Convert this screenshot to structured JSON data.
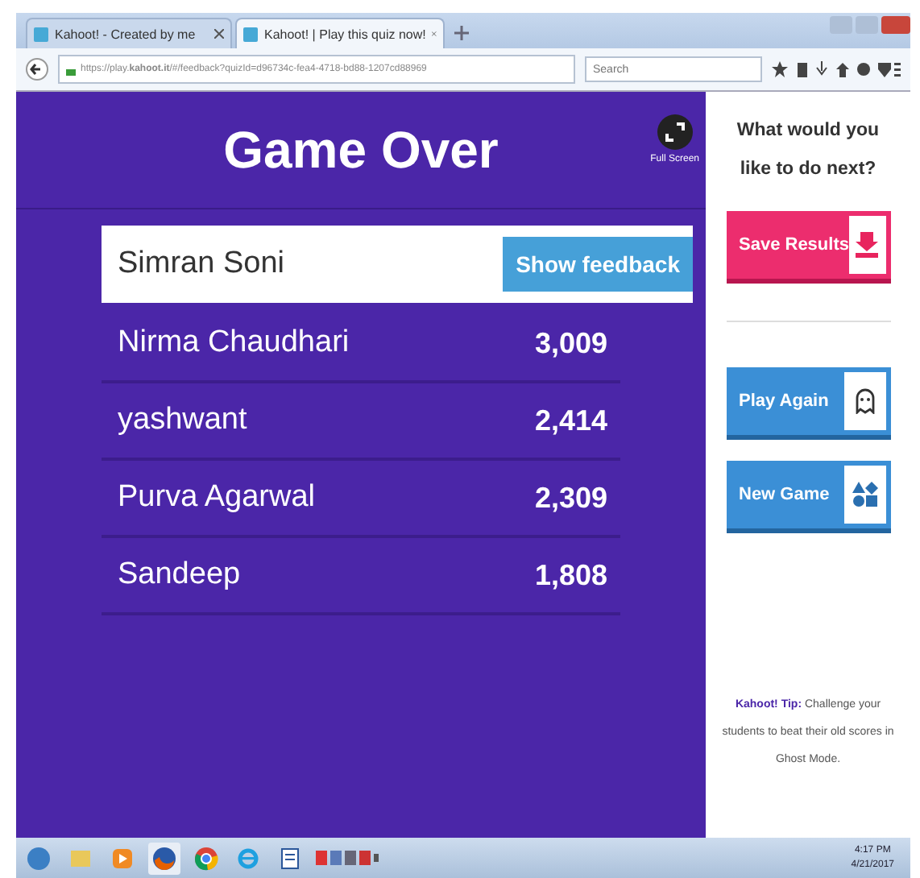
{
  "browser": {
    "tabs": [
      {
        "label": "Kahoot! - Created by me",
        "selected": false
      },
      {
        "label": "Kahoot! | Play this quiz now!",
        "selected": true
      }
    ],
    "url": "https://play.**kahoot.it**/#/feedback?quizId=d96734c-fea4-4718-bd88-1207cd88969",
    "search": {
      "placeholder": "Search"
    }
  },
  "game": {
    "title": "Game Over",
    "fullscreen_label": "Full Screen",
    "feedback_button": "Show feedback",
    "players": [
      {
        "name": "Simran Soni",
        "highlighted": true
      },
      {
        "name": "Nirma Chaudhari",
        "score": "3,009",
        "highlighted": false
      },
      {
        "name": "yashwant",
        "score": "2,414",
        "highlighted": false
      },
      {
        "name": "Purva Agarwal",
        "score": "2,309",
        "highlighted": false
      },
      {
        "name": "Sandeep",
        "score": "1,808",
        "highlighted": false
      }
    ]
  },
  "sidebar": {
    "question": "What would you like to do next?",
    "actions": [
      {
        "label": "Save Results",
        "kind": "save"
      },
      {
        "label": "Play Again",
        "kind": "ghost"
      },
      {
        "label": "New Game",
        "kind": "shapes"
      }
    ],
    "tip": "**Kahoot! Tip:** Challenge your students to beat their old scores in Ghost Mode."
  },
  "taskbar": {
    "time": "4:17 PM",
    "date": "4/21/2017"
  }
}
